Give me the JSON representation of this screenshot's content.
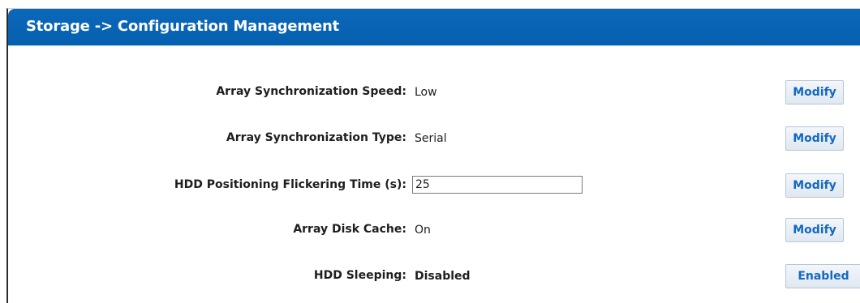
{
  "header": {
    "title": "Storage -> Configuration Management"
  },
  "settings": [
    {
      "label": "Array Synchronization Speed:",
      "value": "Low",
      "button": "Modify"
    },
    {
      "label": "Array Synchronization Type:",
      "value": "Serial",
      "button": "Modify"
    },
    {
      "label": "HDD Positioning Flickering Time (s):",
      "input_value": "25",
      "button": "Modify"
    },
    {
      "label": "Array Disk Cache:",
      "value": "On",
      "button": "Modify"
    },
    {
      "label": "HDD Sleeping:",
      "value": "Disabled",
      "button": "Enabled"
    }
  ],
  "colors": {
    "header_bg": "#0b67b8",
    "header_text": "#ffffff",
    "button_text": "#1467c4"
  }
}
